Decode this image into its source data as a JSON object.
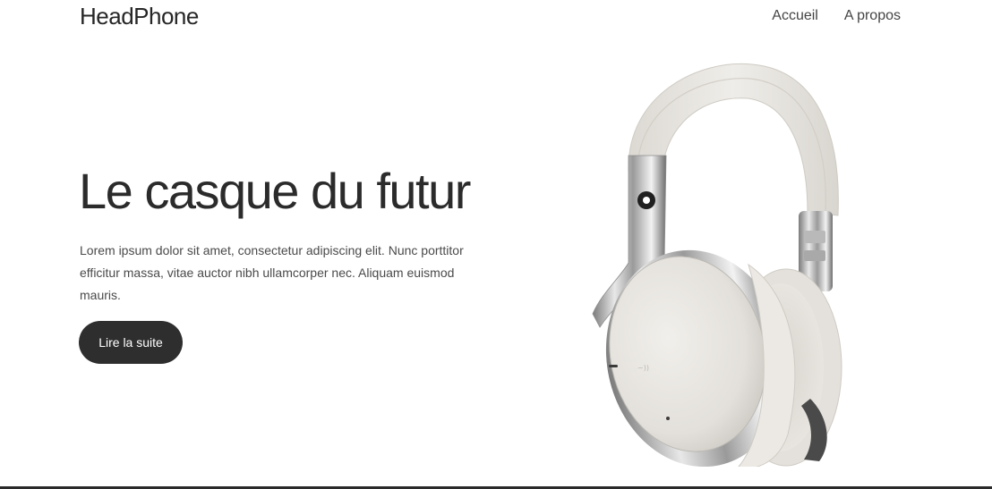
{
  "header": {
    "logo": "HeadPhone",
    "nav": [
      {
        "label": "Accueil"
      },
      {
        "label": "A propos"
      }
    ]
  },
  "hero": {
    "title": "Le casque du futur",
    "description": "Lorem ipsum dolor sit amet, consectetur adipiscing elit. Nunc porttitor efficitur massa, vitae auctor nibh ullamcorper nec. Aliquam euismod mauris.",
    "button_label": "Lire la suite"
  },
  "colors": {
    "text": "#2b2b2b",
    "button_bg": "#2e2e2e",
    "button_text": "#ffffff",
    "headphone_body": "#e6e3de"
  }
}
